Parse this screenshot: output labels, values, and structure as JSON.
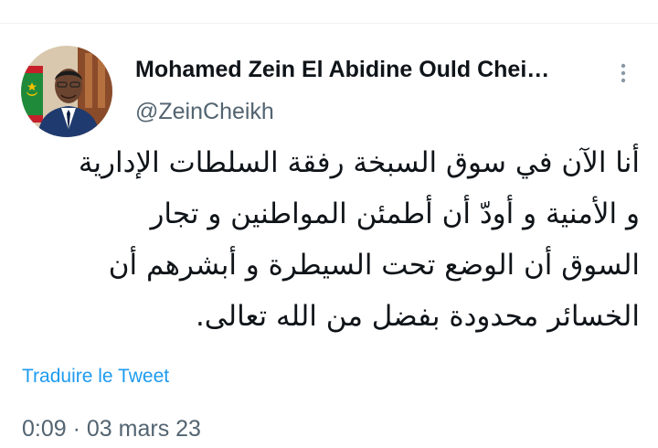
{
  "tweet": {
    "author": {
      "name": "Mohamed Zein El Abidine Ould Chei…",
      "handle": "@ZeinCheikh",
      "avatar_icon": "profile-photo"
    },
    "more_icon": "more-options-vertical-dots",
    "text_lines": [
      "أنا الآن في سوق السبخة رفقة السلطات الإدارية",
      "و الأمنية و أودّ أن أطمئن المواطنين و تجار",
      "السوق أن الوضع تحت السيطرة و أبشرهم أن",
      "الخسائر محدودة بفضل من الله تعالى."
    ],
    "translate_label": "Traduire le Tweet",
    "timestamp": {
      "time": "0:09",
      "separator": " · ",
      "date": "03 mars 23"
    }
  },
  "colors": {
    "text_primary": "#0f1419",
    "text_secondary": "#536471",
    "link": "#1d9bf0",
    "divider": "#eff3f4"
  }
}
